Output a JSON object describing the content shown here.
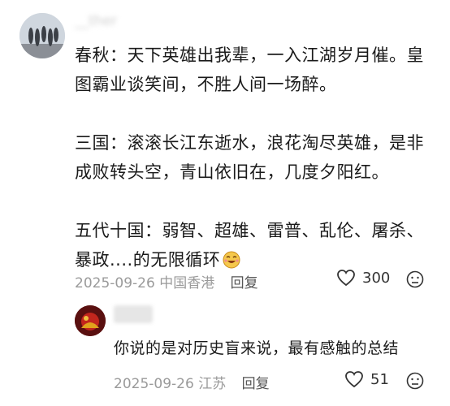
{
  "comment": {
    "username": "__ther",
    "paragraphs": [
      [
        "春秋：天下英雄出我辈，一入江湖岁月催。皇",
        "图霸业谈笑间，不胜人间一场醉。"
      ],
      [
        "三国：滚滚长江东逝水，浪花淘尽英雄，是非",
        "成败转头空，青山依旧在，几度夕阳红。"
      ],
      [
        "五代十国：弱智、超雄、雷普、乱伦、屠杀、",
        "暴政....的无限循环"
      ]
    ],
    "date": "2025-09-26",
    "location": "中国香港",
    "reply_label": "回复",
    "likes": "300"
  },
  "reply": {
    "text": "你说的是对历史盲来说，最有感触的总结",
    "date": "2025-09-26",
    "location": "江苏",
    "reply_label": "回复",
    "likes": "51"
  },
  "colors": {
    "meta": "#9a9a9a",
    "text": "#1a1a1a"
  }
}
